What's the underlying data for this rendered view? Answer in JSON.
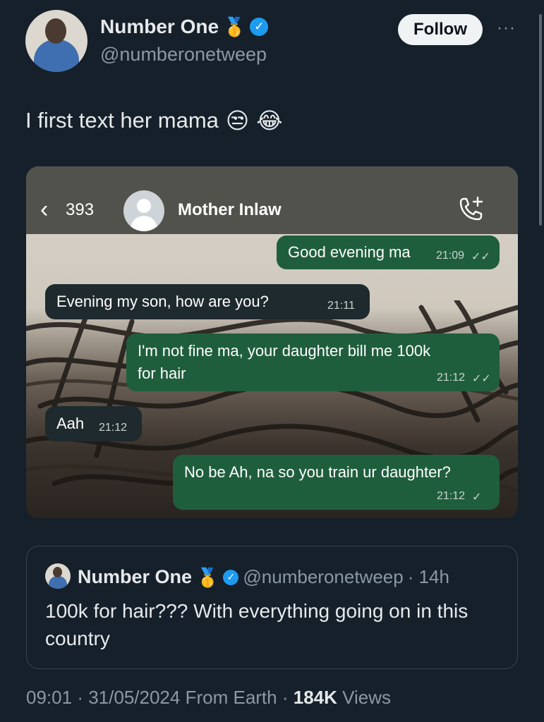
{
  "author": {
    "name": "Number One",
    "badge_emoji": "🥇",
    "handle": "@numberonetweep"
  },
  "follow_label": "Follow",
  "more_label": "···",
  "tweet": {
    "text": "I first text her mama",
    "emojis": [
      "😒",
      "😂"
    ]
  },
  "chat": {
    "unread_count": "393",
    "contact_name": "Mother Inlaw",
    "messages": [
      {
        "dir": "out",
        "text": "Good evening ma",
        "time": "21:09",
        "status": "✓✓"
      },
      {
        "dir": "in",
        "text": "Evening my son, how are you?",
        "time": "21:11"
      },
      {
        "dir": "out",
        "text": "I'm not fine ma, your daughter bill me 100k",
        "text2": "for hair",
        "time": "21:12",
        "status": "✓✓"
      },
      {
        "dir": "in",
        "text": "Aah",
        "time": "21:12"
      },
      {
        "dir": "out",
        "text": "No be Ah, na so you train ur daughter?",
        "time": "21:12",
        "status": "✓"
      }
    ]
  },
  "quote": {
    "name": "Number One",
    "badge_emoji": "🥇",
    "handle": "@numberonetweep",
    "age": "· 14h",
    "text": "100k for hair??? With everything going on in this country"
  },
  "meta": {
    "time": "09:01",
    "date": "31/05/2024",
    "source": "From Earth",
    "views_count": "184K",
    "views_label": "Views"
  },
  "colors": {
    "background": "#15202b",
    "verified": "#1d9bf0",
    "outgoing_bubble": "#1f5e3d",
    "incoming_bubble": "#1f2a2e"
  }
}
